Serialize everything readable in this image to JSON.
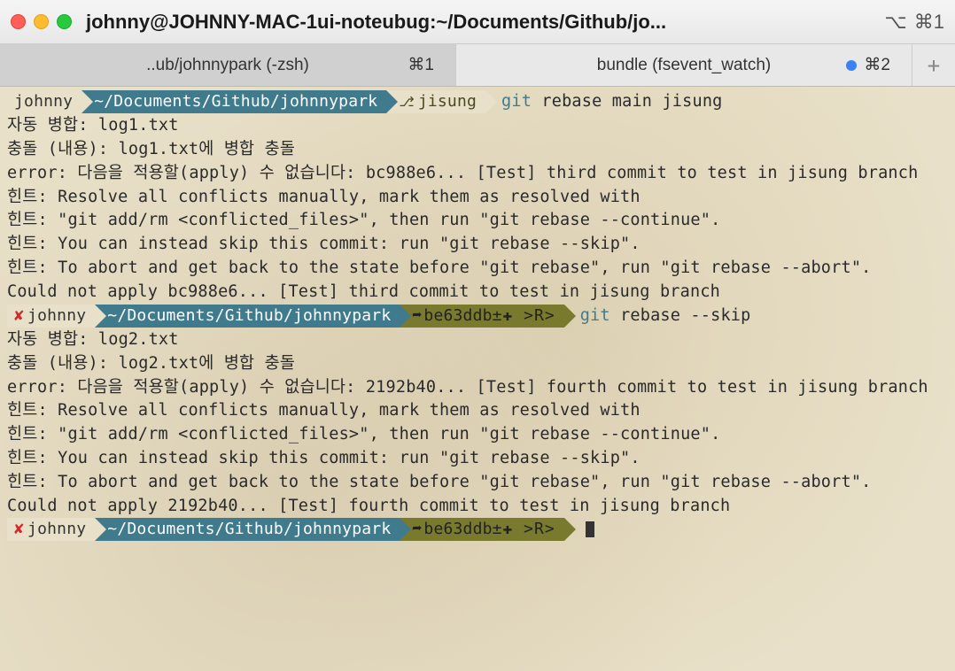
{
  "window": {
    "title": "johnny@JOHNNY-MAC-1ui-noteubug:~/Documents/Github/jo...",
    "shortcut": "⌘1",
    "alt_icon": "⌥"
  },
  "tabs": [
    {
      "label": "..ub/johnnypark (-zsh)",
      "shortcut": "⌘1",
      "active": false
    },
    {
      "label": "bundle (fsevent_watch)",
      "shortcut": "⌘2",
      "active": true,
      "dot": true
    }
  ],
  "prompt1": {
    "user": "johnny",
    "path": "~/Documents/Github/johnnypark",
    "branch": "jisung",
    "cmd_git": "git",
    "cmd_rest": "rebase main jisung"
  },
  "block1": {
    "l1": "자동 병합: log1.txt",
    "l2": "충돌 (내용): log1.txt에 병합 충돌",
    "l3": "error: 다음을 적용할(apply) 수 없습니다: bc988e6... [Test] third commit to test in jisung branch",
    "l4": "힌트: Resolve all conflicts manually, mark them as resolved with",
    "l5": "힌트: \"git add/rm <conflicted_files>\", then run \"git rebase --continue\".",
    "l6": "힌트: You can instead skip this commit: run \"git rebase --skip\".",
    "l7": "힌트: To abort and get back to the state before \"git rebase\", run \"git rebase --abort\".",
    "l8": "Could not apply bc988e6... [Test] third commit to test in jisung branch"
  },
  "prompt2": {
    "user": "johnny",
    "path": "~/Documents/Github/johnnypark",
    "commit": "be63ddb",
    "status": "±✚ >R>",
    "cmd_git": "git",
    "cmd_rest": "rebase --skip"
  },
  "block2": {
    "l1": "자동 병합: log2.txt",
    "l2": "충돌 (내용): log2.txt에 병합 충돌",
    "l3": "error: 다음을 적용할(apply) 수 없습니다: 2192b40... [Test] fourth commit to test in jisung branch",
    "l4": "힌트: Resolve all conflicts manually, mark them as resolved with",
    "l5": "힌트: \"git add/rm <conflicted_files>\", then run \"git rebase --continue\".",
    "l6": "힌트: You can instead skip this commit: run \"git rebase --skip\".",
    "l7": "힌트: To abort and get back to the state before \"git rebase\", run \"git rebase --abort\".",
    "l8": "Could not apply 2192b40... [Test] fourth commit to test in jisung branch"
  },
  "prompt3": {
    "user": "johnny",
    "path": "~/Documents/Github/johnnypark",
    "commit": "be63ddb",
    "status": "±✚ >R>"
  },
  "colors": {
    "bg": "#e8e0c8",
    "path": "#3f7b8c",
    "branch": "#7a7a2e",
    "error_x": "#d62828"
  }
}
